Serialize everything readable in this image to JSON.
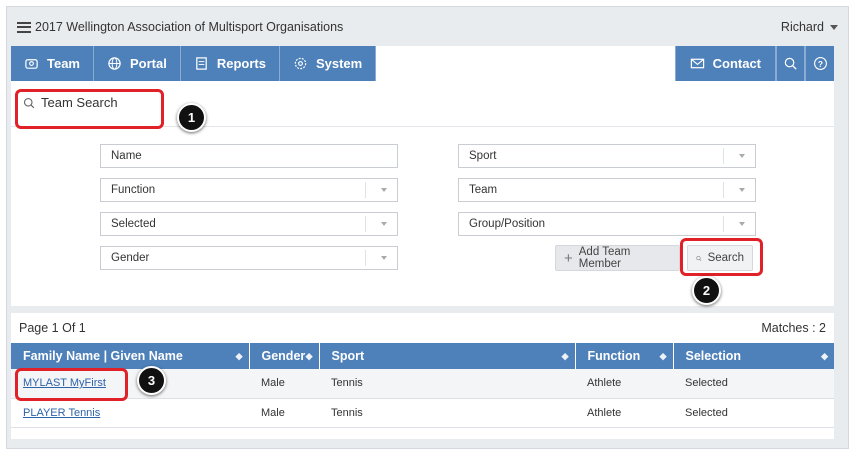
{
  "header": {
    "org_title": "2017 Wellington Association of Multisport Organisations",
    "user_name": "Richard"
  },
  "nav": {
    "items": [
      {
        "label": "Team",
        "icon": "team-icon"
      },
      {
        "label": "Portal",
        "icon": "globe-icon"
      },
      {
        "label": "Reports",
        "icon": "report-icon"
      },
      {
        "label": "System",
        "icon": "gear-icon"
      }
    ],
    "contact_label": "Contact",
    "right_icons": [
      "search-icon",
      "help-icon"
    ]
  },
  "search_panel": {
    "title": "Team Search",
    "fields": {
      "name_placeholder": "Name",
      "function": "Function",
      "selected": "Selected",
      "gender": "Gender",
      "sport": "Sport",
      "team": "Team",
      "group_position": "Group/Position"
    },
    "add_member_label": "Add Team Member",
    "search_label": "Search"
  },
  "callouts": [
    "1",
    "2",
    "3"
  ],
  "results": {
    "page_info": "Page 1 Of 1",
    "matches": "Matches : 2",
    "columns": [
      "Family Name | Given Name",
      "Gender",
      "Sport",
      "Function",
      "Selection"
    ],
    "rows": [
      {
        "name": "MYLAST MyFirst",
        "gender": "Male",
        "sport": "Tennis",
        "function": "Athlete",
        "selection": "Selected"
      },
      {
        "name": "PLAYER Tennis",
        "gender": "Male",
        "sport": "Tennis",
        "function": "Athlete",
        "selection": "Selected"
      }
    ]
  },
  "colors": {
    "nav_blue": "#4e80b9",
    "highlight_red": "#e02128",
    "link_blue": "#2d63a8"
  }
}
